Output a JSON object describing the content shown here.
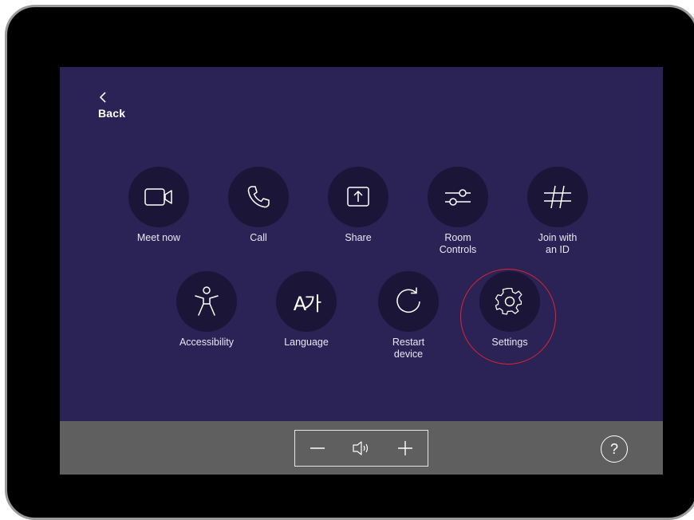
{
  "header": {
    "back_label": "Back"
  },
  "menu": {
    "row1": [
      {
        "label": "Meet now",
        "icon": "video-camera-icon"
      },
      {
        "label": "Call",
        "icon": "phone-icon"
      },
      {
        "label": "Share",
        "icon": "share-screen-icon"
      },
      {
        "label": "Room\nControls",
        "icon": "sliders-icon"
      },
      {
        "label": "Join with\nan ID",
        "icon": "hashtag-icon"
      }
    ],
    "row2": [
      {
        "label": "Accessibility",
        "icon": "accessibility-icon"
      },
      {
        "label": "Language",
        "icon": "language-icon",
        "glyph": "A가"
      },
      {
        "label": "Restart\ndevice",
        "icon": "restart-icon"
      },
      {
        "label": "Settings",
        "icon": "gear-icon",
        "highlighted": true
      }
    ]
  },
  "bottom_bar": {
    "volume_down": "volume-down-icon",
    "speaker": "speaker-icon",
    "volume_up": "volume-up-icon",
    "help_label": "?"
  },
  "colors": {
    "screen_bg": "#2b2256",
    "tile_bg": "#1b1537",
    "bottom_bar_bg": "#5f5f5f",
    "highlight": "#e0242f",
    "bezel": "#000000"
  }
}
